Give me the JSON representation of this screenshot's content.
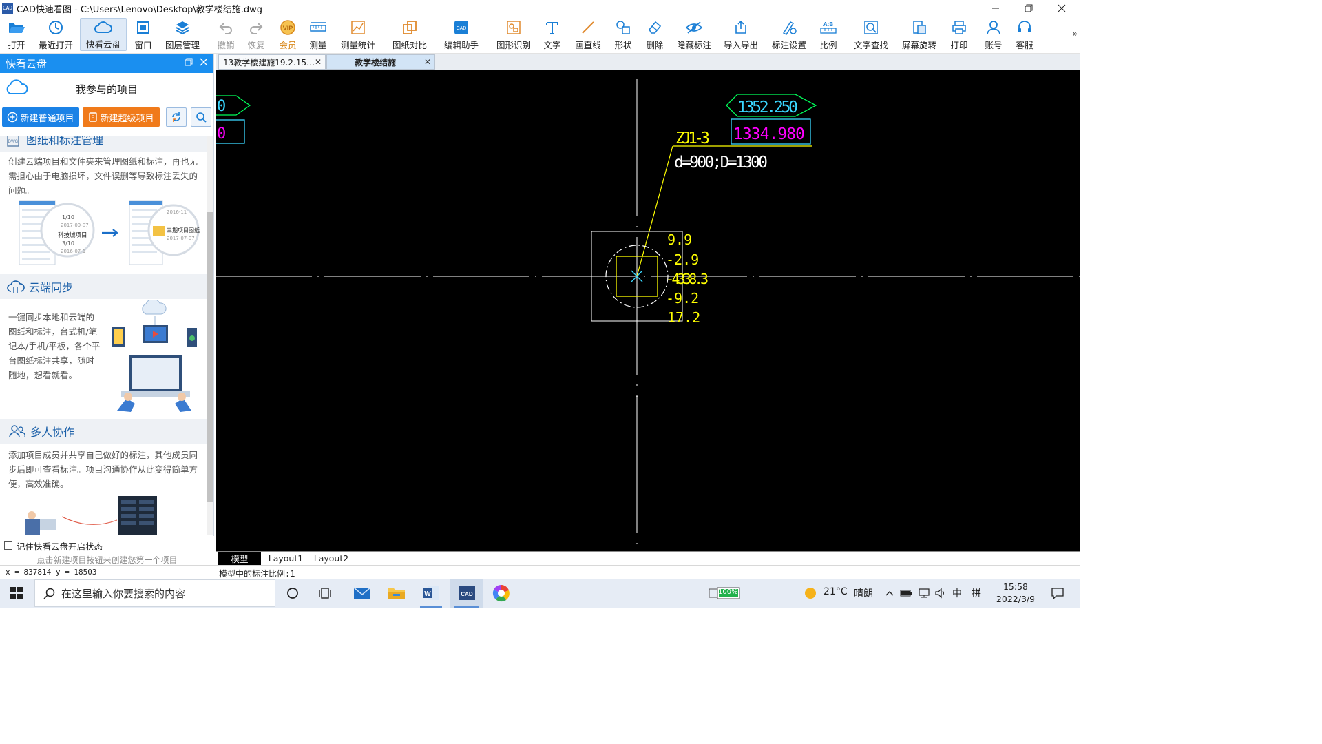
{
  "window": {
    "app_icon": "CAD",
    "title": "CAD快速看图 - C:\\Users\\Lenovo\\Desktop\\教学楼结施.dwg",
    "controls": [
      "minimize-icon",
      "restore-icon",
      "close-icon"
    ]
  },
  "toolbar": {
    "items": [
      {
        "label": "打开",
        "icon": "folder-open-icon"
      },
      {
        "label": "最近打开",
        "icon": "history-icon"
      },
      {
        "label": "快看云盘",
        "icon": "cloud-icon",
        "active": true
      },
      {
        "label": "窗口",
        "icon": "window-icon"
      },
      {
        "label": "图层管理",
        "icon": "layers-icon"
      },
      {
        "label": "撤销",
        "icon": "undo-icon",
        "disabled": true
      },
      {
        "label": "恢复",
        "icon": "redo-icon",
        "disabled": true
      },
      {
        "label": "会员",
        "icon": "vip-icon",
        "vip": true
      },
      {
        "label": "测量",
        "icon": "ruler-icon"
      },
      {
        "label": "测量统计",
        "icon": "measure-stats-icon"
      },
      {
        "label": "图纸对比",
        "icon": "compare-icon"
      },
      {
        "label": "编辑助手",
        "icon": "edit-assistant-icon"
      },
      {
        "label": "图形识别",
        "icon": "shape-recognition-icon"
      },
      {
        "label": "文字",
        "icon": "text-icon"
      },
      {
        "label": "画直线",
        "icon": "line-icon"
      },
      {
        "label": "形状",
        "icon": "shapes-icon"
      },
      {
        "label": "删除",
        "icon": "eraser-icon"
      },
      {
        "label": "隐藏标注",
        "icon": "hide-eye-icon"
      },
      {
        "label": "导入导出",
        "icon": "import-export-icon"
      },
      {
        "label": "标注设置",
        "icon": "annotation-settings-icon"
      },
      {
        "label": "比例",
        "icon": "scale-icon"
      },
      {
        "label": "文字查找",
        "icon": "text-search-icon"
      },
      {
        "label": "屏幕旋转",
        "icon": "rotate-screen-icon"
      },
      {
        "label": "打印",
        "icon": "printer-icon"
      },
      {
        "label": "账号",
        "icon": "user-icon"
      },
      {
        "label": "客服",
        "icon": "headset-icon"
      }
    ],
    "more": "»"
  },
  "left_panel": {
    "header": "快看云盘",
    "subtitle": "我参与的项目",
    "new_normal_project": "新建普通项目",
    "new_super_project": "新建超级项目",
    "sections": [
      {
        "title": "图纸和标注管理",
        "text": "创建云端项目和文件夹来管理图纸和标注，再也无需担心由于电脑损坏，文件误删等导致标注丢失的问题。",
        "illustration": {
          "left_labels": [
            "1/10",
            "2017-09-07",
            "科技城项目",
            "3/10",
            "2016-07-1"
          ],
          "right_labels": [
            "2016-11",
            "三期项目图纸",
            "2017-07-07"
          ]
        }
      },
      {
        "title": "云端同步",
        "text": "一键同步本地和云端的图纸和标注，台式机/笔记本/手机/平板，各个平台图纸标注共享，随时随地，想看就看。"
      },
      {
        "title": "多人协作",
        "text": "添加项目成员并共享自己做好的标注，其他成员同步后即可查看标注。项目沟通协作从此变得简单方便，高效准确。"
      }
    ],
    "remember_state": "记住快看云盘开启状态",
    "hint": "点击新建项目按钮来创建您第一个项目"
  },
  "doc_tabs": [
    {
      "label": "13教学楼建施19.2.15…",
      "active": false
    },
    {
      "label": "教学楼结施",
      "active": true
    }
  ],
  "drawing": {
    "elevation_top": "1352.250",
    "elevation_bottom": "1334.980",
    "left_fragment_top": "0",
    "left_fragment_bottom": "0",
    "pile_id": "ZJ1-3",
    "pile_spec": "d=900;D=1300",
    "values": [
      "9.9",
      "-2.9",
      "-4338.3",
      "-9.2",
      "17.2"
    ],
    "colors": {
      "green": "#00ff5a",
      "magenta": "#ff00ff",
      "cyan": "#3ad7ff",
      "yellow": "#ffff00",
      "white": "#ffffff"
    }
  },
  "layout_tabs": [
    "模型",
    "Layout1",
    "Layout2"
  ],
  "status": {
    "coords": "x = 837814  y = 18503",
    "scale": "模型中的标注比例:1"
  },
  "taskbar": {
    "search_placeholder": "在这里输入你要搜索的内容",
    "battery": "100%",
    "weather_temp": "21°C",
    "weather_desc": "晴朗",
    "ime_lang": "中",
    "ime_mode": "拼",
    "time": "15:58",
    "date": "2022/3/9"
  }
}
